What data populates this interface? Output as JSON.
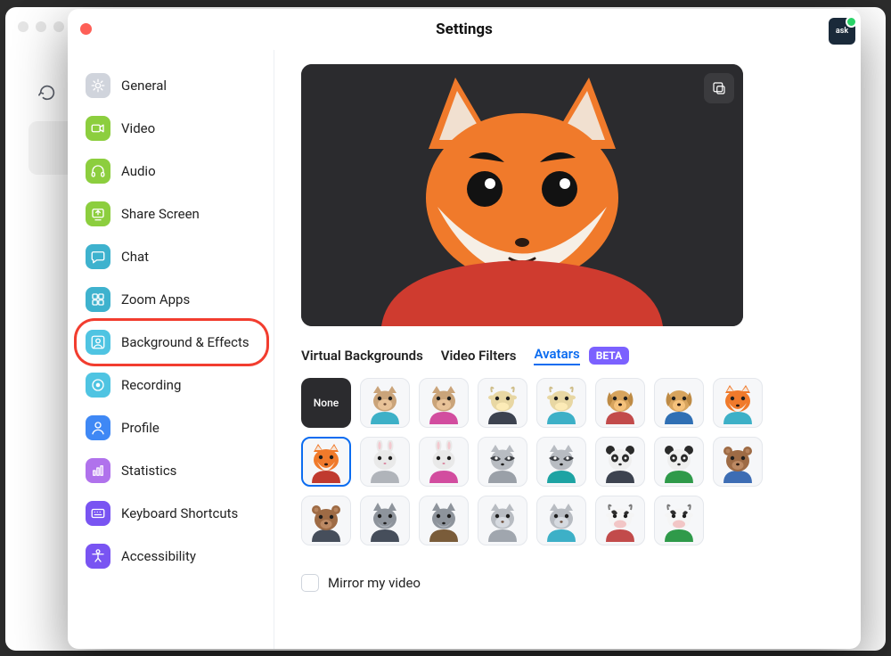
{
  "window_title": "Settings",
  "sidebar": {
    "items": [
      {
        "label": "General",
        "color": "#d0d4dc",
        "icon": "gear"
      },
      {
        "label": "Video",
        "color": "#8cce3e",
        "icon": "camera"
      },
      {
        "label": "Audio",
        "color": "#8cce3e",
        "icon": "headphones"
      },
      {
        "label": "Share Screen",
        "color": "#8cce3e",
        "icon": "share"
      },
      {
        "label": "Chat",
        "color": "#3eb2ce",
        "icon": "chat"
      },
      {
        "label": "Zoom Apps",
        "color": "#3eb2ce",
        "icon": "apps"
      },
      {
        "label": "Background & Effects",
        "color": "#4fc4e2",
        "icon": "person"
      },
      {
        "label": "Recording",
        "color": "#4fc4e2",
        "icon": "record"
      },
      {
        "label": "Profile",
        "color": "#3f88f5",
        "icon": "profile"
      },
      {
        "label": "Statistics",
        "color": "#b072ec",
        "icon": "stats"
      },
      {
        "label": "Keyboard Shortcuts",
        "color": "#7954f2",
        "icon": "keyboard"
      },
      {
        "label": "Accessibility",
        "color": "#7954f2",
        "icon": "accessibility"
      }
    ],
    "active_index": 6
  },
  "tabs": {
    "items": [
      "Virtual Backgrounds",
      "Video Filters",
      "Avatars"
    ],
    "active_index": 2,
    "beta_label": "BETA"
  },
  "avatar_tiles": {
    "none_label": "None",
    "selected_index": 8,
    "tiles": [
      {
        "type": "none"
      },
      {
        "animal": "cat",
        "head": "#caa47a",
        "shirt": "#3db0c7"
      },
      {
        "animal": "cat",
        "head": "#caa47a",
        "shirt": "#d24d9f"
      },
      {
        "animal": "cow",
        "head": "#e8d7a3",
        "shirt": "#3d4350"
      },
      {
        "animal": "cow",
        "head": "#e8d7a3",
        "shirt": "#3db0c7"
      },
      {
        "animal": "dog",
        "head": "#d7a45e",
        "shirt": "#c24b4b"
      },
      {
        "animal": "dog",
        "head": "#d7a45e",
        "shirt": "#2f6fb4"
      },
      {
        "animal": "fox",
        "head": "#f07a2b",
        "shirt": "#3db0c7"
      },
      {
        "animal": "fox",
        "head": "#f07a2b",
        "shirt": "#c03a2f"
      },
      {
        "animal": "rabbit",
        "head": "#e9e9e9",
        "shirt": "#b0b4ba"
      },
      {
        "animal": "rabbit",
        "head": "#e9e9e9",
        "shirt": "#d24d9f"
      },
      {
        "animal": "racc",
        "head": "#b8bcc2",
        "shirt": "#9aa0a8"
      },
      {
        "animal": "racc",
        "head": "#b8bcc2",
        "shirt": "#1da3a3"
      },
      {
        "animal": "panda",
        "head": "#efefef",
        "shirt": "#3d4350"
      },
      {
        "animal": "panda",
        "head": "#efefef",
        "shirt": "#2f9a4a"
      },
      {
        "animal": "bear",
        "head": "#9e6b45",
        "shirt": "#3d6db4"
      },
      {
        "animal": "bear",
        "head": "#9e6b45",
        "shirt": "#464e5b"
      },
      {
        "animal": "wolf",
        "head": "#8e949c",
        "shirt": "#464e5b"
      },
      {
        "animal": "wolf",
        "head": "#8e949c",
        "shirt": "#7a5c3a"
      },
      {
        "animal": "cat",
        "head": "#b8bcc2",
        "shirt": "#a0a6ae"
      },
      {
        "animal": "cat",
        "head": "#b8bcc2",
        "shirt": "#3db0c7"
      },
      {
        "animal": "cow2",
        "head": "#f5f5f5",
        "shirt": "#c24b4b"
      },
      {
        "animal": "cow2",
        "head": "#f5f5f5",
        "shirt": "#2f9a4a"
      }
    ]
  },
  "preview_avatar": {
    "animal": "fox",
    "head": "#f07a2b",
    "shirt": "#cf3b2f"
  },
  "mirror_label": "Mirror my video",
  "mirror_checked": false,
  "account_initials": "ask"
}
